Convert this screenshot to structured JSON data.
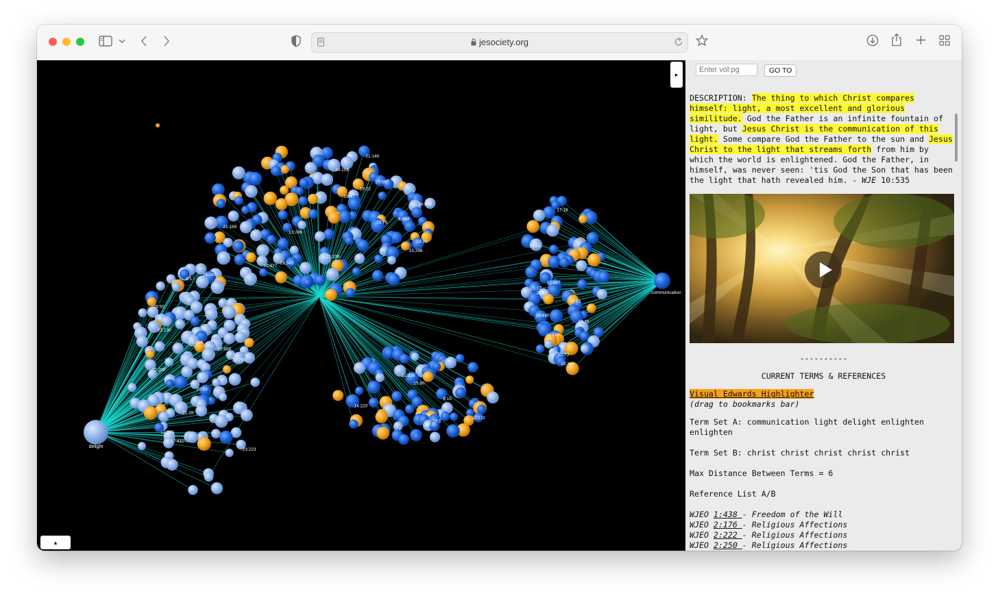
{
  "browser": {
    "url": "jesociety.org"
  },
  "graph": {
    "hub_left_label": "delight",
    "hub_right_label": "communication",
    "collapse_glyph": "▸",
    "expand_glyph": "▴",
    "node_labels": [
      "21:140",
      "24:108",
      "25:667",
      "19:22",
      "18:47",
      "16:450",
      "17:18",
      "8:484",
      "16:78",
      "21:189",
      "13:206",
      "14:15",
      "19:23",
      "15:298",
      "22:236",
      "23:543",
      "10:477",
      "24:280",
      "9:17",
      "12:497",
      "21:17",
      "22:80",
      "18:83",
      "25:50",
      "16:440",
      "19:76",
      "21:130",
      "21:177",
      "21:384",
      "22:454",
      "20:70",
      "22:255",
      "25:340",
      "15:208",
      "12:336",
      "15:60",
      "20:53",
      "8:15",
      "14:220",
      "21:15",
      "22:272",
      "18:1",
      "20:70",
      "12:325",
      "17:410",
      "23:223",
      "22:60",
      "8:18",
      "17:18",
      "14:429"
    ],
    "colors": {
      "background": "#000000",
      "edges": "#19d8d0",
      "node_dark_blue": "#1e64d8",
      "node_light_blue": "#8fb3ea",
      "node_orange": "#f2a21b",
      "label": "#ffffff"
    }
  },
  "sidebar": {
    "vol_input_placeholder": "Enter vol:pg",
    "goto_label": "GO TO",
    "desc_prefix": "DESCRIPTION: ",
    "desc_h1": "The thing to which Christ compares himself: light, a most excellent and glorious similitude.",
    "desc_t1": " God the Father is an infinite fountain of light, but ",
    "desc_h2": "Jesus Christ is the communication of this light.",
    "desc_t2": " Some compare God the Father to the sun and ",
    "desc_h3": "Jesus Christ to the light that streams forth",
    "desc_t3": " from him by which the world is enlightened. God the Father, in himself, was never seen: 'tis God the Son that has been the light that hath revealed him. - ",
    "desc_cite": "WJE",
    "desc_page": " 10:535",
    "separator": "----------",
    "current_terms_title": "CURRENT TERMS & REFERENCES",
    "highlighter_link": "Visual Edwards Highlighter",
    "drag_hint": "(drag to bookmarks bar)",
    "term_set_a": "Term Set A: communication light delight enlighten enlighten",
    "term_set_b": "Term Set B: christ christ christ christ christ",
    "max_distance": "Max Distance Between Terms = 6",
    "reference_list_title": "Reference List A/B",
    "references": [
      {
        "prefix": "WJEO ",
        "page": "1:438 ",
        "title": "- Freedom of the Will"
      },
      {
        "prefix": "WJEO ",
        "page": "2:176 ",
        "title": "- Religious Affections"
      },
      {
        "prefix": "WJEO ",
        "page": "2:222 ",
        "title": "- Religious Affections"
      },
      {
        "prefix": "WJEO ",
        "page": "2:250 ",
        "title": "- Religious Affections"
      }
    ]
  }
}
